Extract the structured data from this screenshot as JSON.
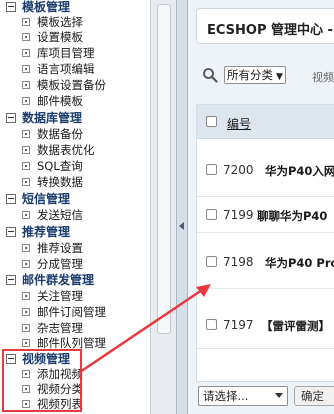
{
  "sidebar": {
    "groups": [
      {
        "label": "模板管理",
        "items": [
          "模板选择",
          "设置模板",
          "库项目管理",
          "语言项编辑",
          "模板设置备份",
          "邮件模板"
        ]
      },
      {
        "label": "数据库管理",
        "items": [
          "数据备份",
          "数据表优化",
          "SQL查询",
          "转换数据"
        ]
      },
      {
        "label": "短信管理",
        "items": [
          "发送短信"
        ]
      },
      {
        "label": "推荐管理",
        "items": [
          "推荐设置",
          "分成管理"
        ]
      },
      {
        "label": "邮件群发管理",
        "items": [
          "关注管理",
          "邮件订阅管理",
          "杂志管理",
          "邮件队列管理"
        ]
      },
      {
        "label": "视频管理",
        "items": [
          "添加视频",
          "视频分类",
          "视频列表"
        ]
      }
    ]
  },
  "header": {
    "title": "ECSHOP 管理中心 -"
  },
  "search": {
    "category": "所有分类",
    "field_label": "视频"
  },
  "table": {
    "header_id": "编号",
    "rows": [
      {
        "id": "7200",
        "name": "华为P40入网"
      },
      {
        "id": "7199",
        "name": "聊聊华为P40"
      },
      {
        "id": "7198",
        "name": "华为P40 Pro"
      },
      {
        "id": "7197",
        "name": "【雷评雷测】"
      }
    ]
  },
  "footer": {
    "batch_select": "请选择...",
    "confirm": "确定"
  },
  "colors": {
    "annotation": "#e8393f",
    "group_text": "#1a3c6e",
    "table_header": "#dde6ee"
  }
}
